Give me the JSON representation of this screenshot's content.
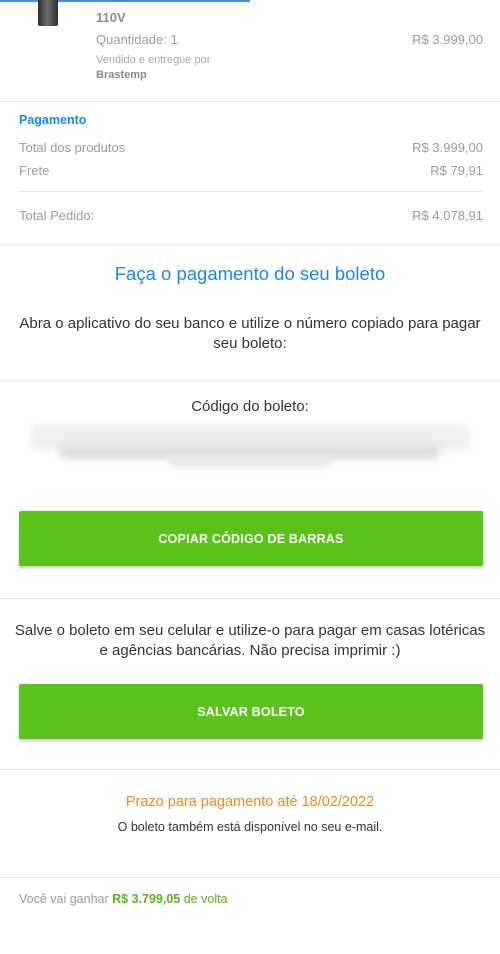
{
  "product": {
    "variant": "110V",
    "quantity": "Quantidade: 1",
    "price": "R$ 3.999,00",
    "seller_label": "Vendido e entregue por",
    "seller": "Brastemp"
  },
  "payment": {
    "title": "Pagamento",
    "products_label": "Total dos produtos",
    "products_value": "R$ 3.999,00",
    "shipping_label": "Frete",
    "shipping_value": "R$ 79,91",
    "total_label": "Total Pedido:",
    "total_value": "R$ 4.078,91"
  },
  "instructions": {
    "title": "Faça o pagamento do seu boleto",
    "text": "Abra o aplicativo do seu banco e utilize o número copiado para pagar seu boleto:"
  },
  "boleto_code": {
    "label": "Código do boleto:",
    "copy_button": "COPIAR CÓDIGO DE BARRAS"
  },
  "save": {
    "text": "Salve o boleto em seu celular e utilize-o para pagar em casas lotéricas e agências bancárias. Não precisa imprimir :)",
    "button": "SALVAR BOLETO"
  },
  "deadline": {
    "text": "Prazo para pagamento até 18/02/2022",
    "email_note": "O boleto também está disponível no seu e-mail."
  },
  "cashback": {
    "prefix": "Você vai ganhar",
    "amount": "R$ 3.799,05",
    "suffix": "de volta"
  },
  "colors": {
    "accent_blue": "#1a86e8",
    "button_green": "#5ac21a",
    "deadline_orange": "#f0861e",
    "cashback_green": "#5ab31a"
  }
}
